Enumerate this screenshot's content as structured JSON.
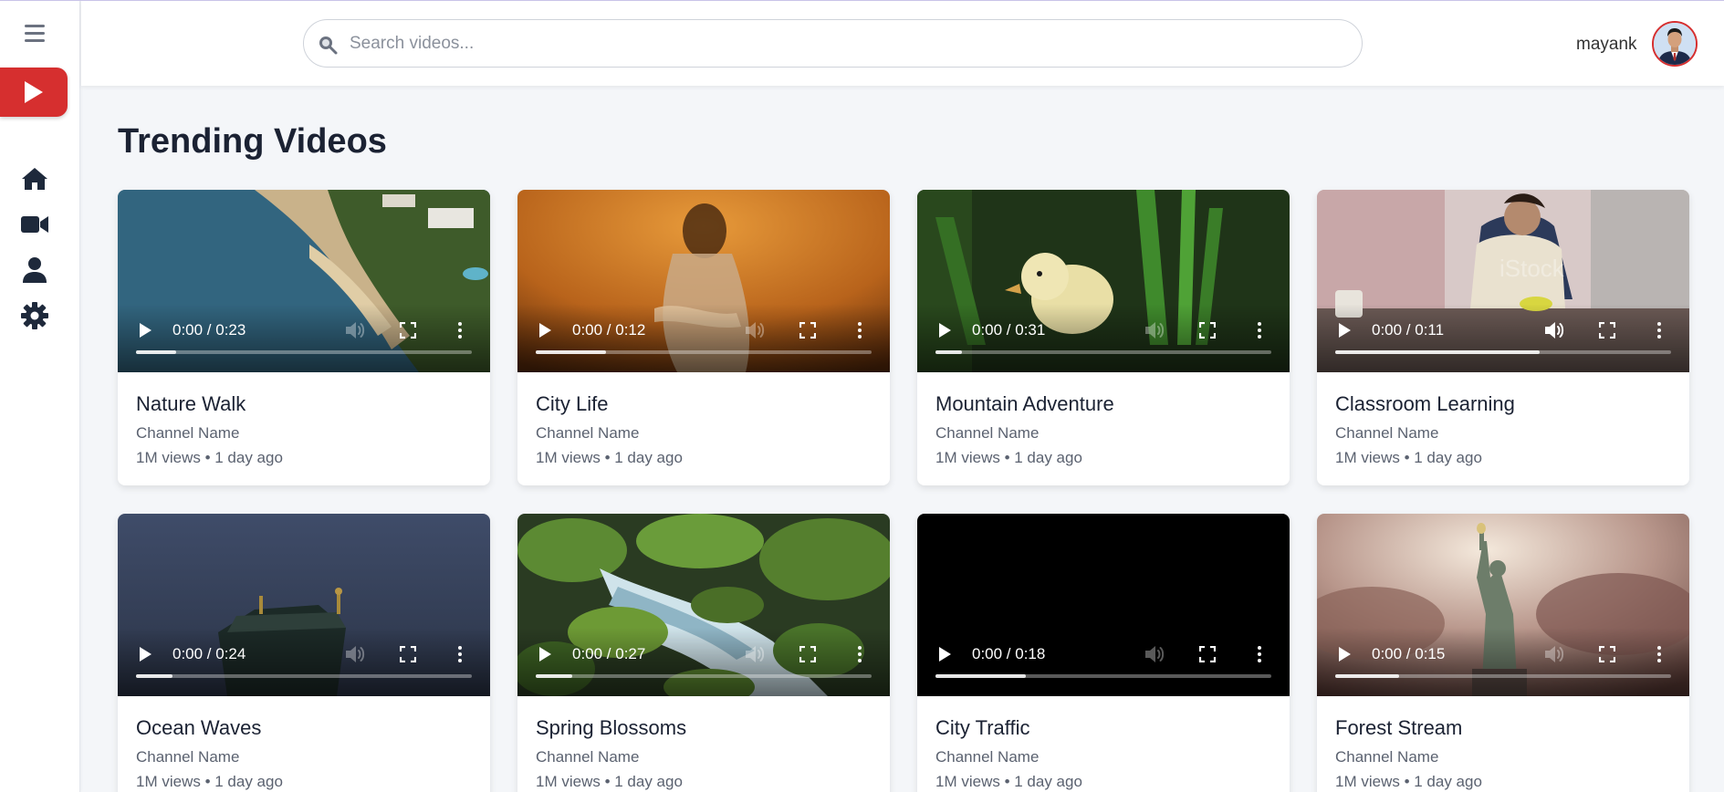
{
  "search": {
    "placeholder": "Search videos..."
  },
  "user": {
    "name": "mayank"
  },
  "page": {
    "title": "Trending Videos"
  },
  "sidebar": {
    "items": [
      {
        "name": "home-icon"
      },
      {
        "name": "video-camera-icon"
      },
      {
        "name": "user-icon"
      },
      {
        "name": "settings-icon"
      }
    ]
  },
  "colors": {
    "accent": "#d62f2f",
    "background": "#f4f6f9"
  },
  "videos": [
    {
      "title": "Nature Walk",
      "channel": "Channel Name",
      "meta": "1M views • 1 day ago",
      "time": "0:00 / 0:23",
      "progress": 0.12,
      "muted": true,
      "thumb": "coast"
    },
    {
      "title": "City Life",
      "channel": "Channel Name",
      "meta": "1M views • 1 day ago",
      "time": "0:00 / 0:12",
      "progress": 0.21,
      "muted": true,
      "thumb": "sunset"
    },
    {
      "title": "Mountain Adventure",
      "channel": "Channel Name",
      "meta": "1M views • 1 day ago",
      "time": "0:00 / 0:31",
      "progress": 0.08,
      "muted": true,
      "thumb": "duck"
    },
    {
      "title": "Classroom Learning",
      "channel": "Channel Name",
      "meta": "1M views • 1 day ago",
      "time": "0:00 / 0:11",
      "progress": 0.61,
      "muted": false,
      "thumb": "classroom"
    },
    {
      "title": "Ocean Waves",
      "channel": "Channel Name",
      "meta": "1M views • 1 day ago",
      "time": "0:00 / 0:24",
      "progress": 0.11,
      "muted": true,
      "thumb": "dusk"
    },
    {
      "title": "Spring Blossoms",
      "channel": "Channel Name",
      "meta": "1M views • 1 day ago",
      "time": "0:00 / 0:27",
      "progress": 0.11,
      "muted": true,
      "thumb": "stream"
    },
    {
      "title": "City Traffic",
      "channel": "Channel Name",
      "meta": "1M views • 1 day ago",
      "time": "0:00 / 0:18",
      "progress": 0.27,
      "muted": true,
      "thumb": "black"
    },
    {
      "title": "Forest Stream",
      "channel": "Channel Name",
      "meta": "1M views • 1 day ago",
      "time": "0:00 / 0:15",
      "progress": 0.19,
      "muted": true,
      "thumb": "liberty"
    }
  ]
}
